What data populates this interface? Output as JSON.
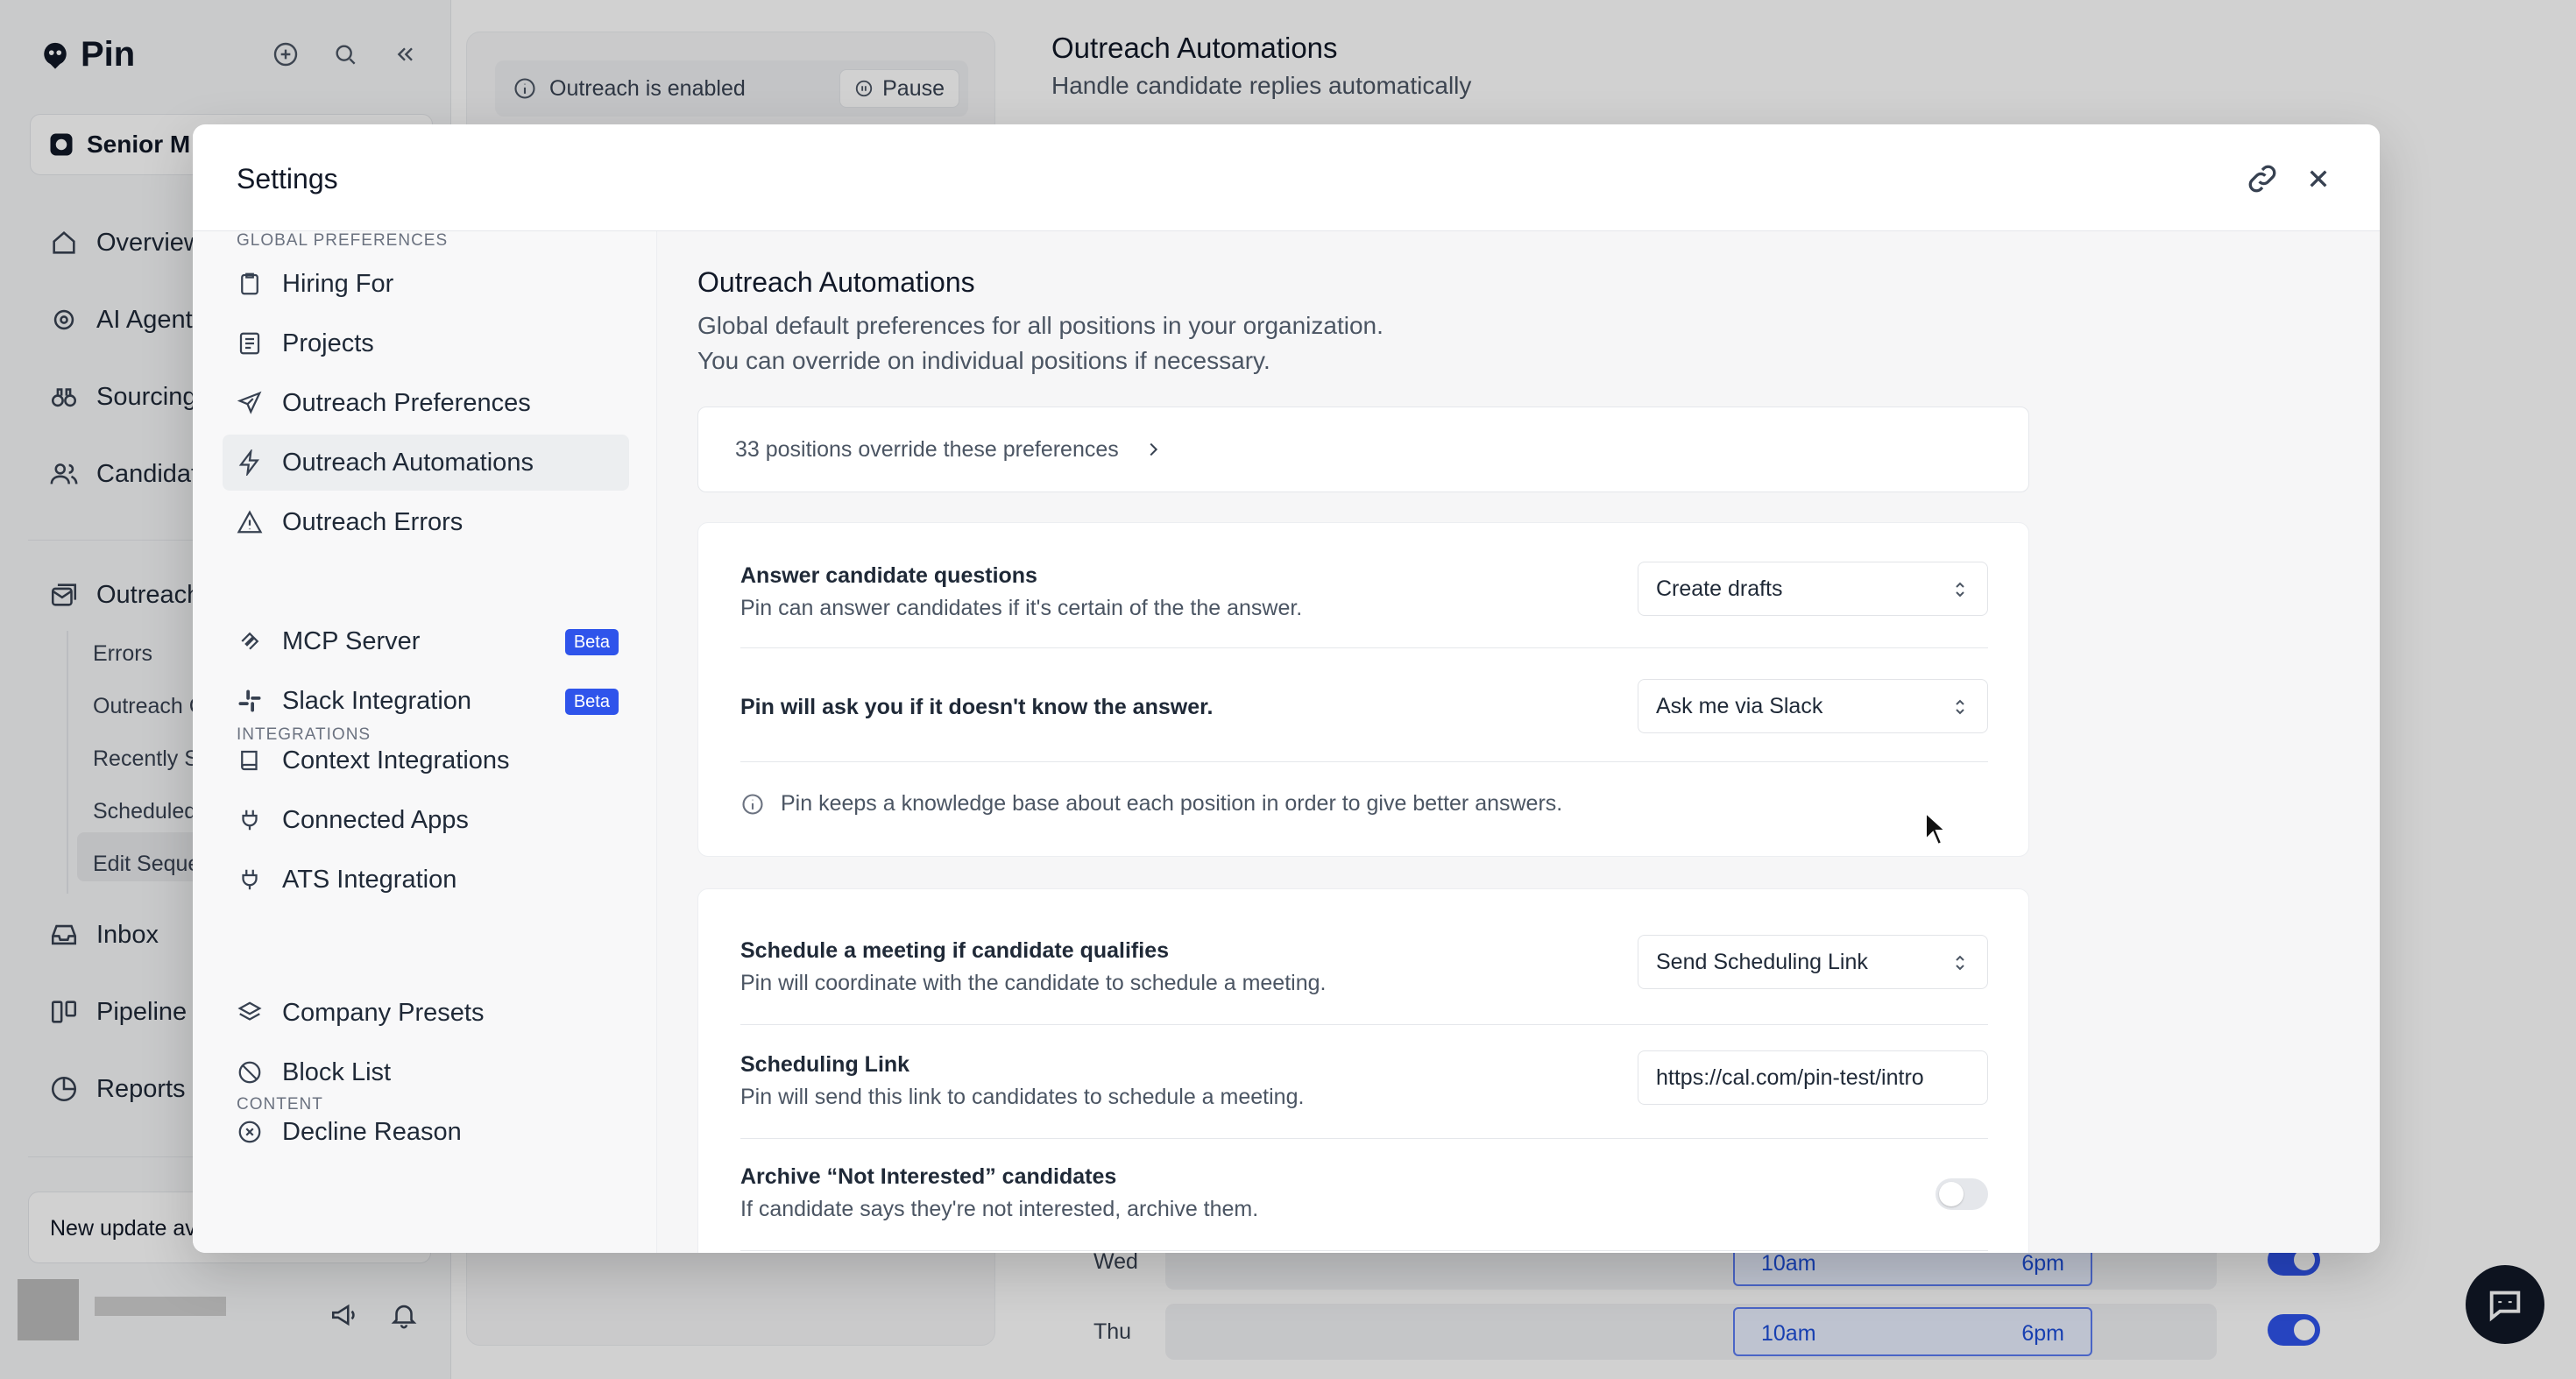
{
  "app": {
    "brand": "Pin",
    "project_name": "Senior M",
    "nav": [
      {
        "label": "Overview",
        "icon": "home-icon"
      },
      {
        "label": "AI Agent",
        "icon": "sparkle-gear-icon"
      },
      {
        "label": "Sourcing",
        "icon": "binoculars-icon"
      },
      {
        "label": "Candidat",
        "icon": "users-icon"
      },
      {
        "label": "Outreach",
        "icon": "mail-stack-icon"
      }
    ],
    "outreach_sub": [
      "Errors",
      "Outreach C",
      "Recently S",
      "Scheduled",
      "Edit Seque"
    ],
    "nav_bottom": [
      {
        "label": "Inbox",
        "icon": "inbox-icon"
      },
      {
        "label": "Pipeline",
        "icon": "columns-icon"
      },
      {
        "label": "Reports",
        "icon": "pie-chart-icon"
      }
    ],
    "update_text": "New update av",
    "outreach_status": "Outreach is enabled",
    "pause_label": "Pause",
    "page_title": "Outreach Automations",
    "page_subtitle": "Handle candidate replies automatically",
    "schedule": [
      {
        "day": "Wed",
        "start": "10am",
        "end": "6pm",
        "enabled": true
      },
      {
        "day": "Thu",
        "start": "10am",
        "end": "6pm",
        "enabled": true
      }
    ]
  },
  "modal": {
    "title": "Settings",
    "nav_sections": [
      {
        "label": "GLOBAL PREFERENCES",
        "items": [
          {
            "label": "Hiring For",
            "icon": "clipboard-icon"
          },
          {
            "label": "Projects",
            "icon": "list-doc-icon"
          },
          {
            "label": "Outreach Preferences",
            "icon": "send-icon"
          },
          {
            "label": "Outreach Automations",
            "icon": "lightning-icon",
            "active": true
          },
          {
            "label": "Outreach Errors",
            "icon": "warning-icon"
          }
        ]
      },
      {
        "label": "INTEGRATIONS",
        "items": [
          {
            "label": "MCP Server",
            "icon": "mcp-icon",
            "badge": "Beta"
          },
          {
            "label": "Slack Integration",
            "icon": "slack-icon",
            "badge": "Beta"
          },
          {
            "label": "Context Integrations",
            "icon": "book-icon"
          },
          {
            "label": "Connected Apps",
            "icon": "plug-icon"
          },
          {
            "label": "ATS Integration",
            "icon": "plug-icon"
          }
        ]
      },
      {
        "label": "CONTENT",
        "items": [
          {
            "label": "Company Presets",
            "icon": "layers-icon"
          },
          {
            "label": "Block List",
            "icon": "ban-icon"
          },
          {
            "label": "Decline Reason",
            "icon": "x-circle-icon"
          }
        ]
      }
    ],
    "content": {
      "title": "Outreach Automations",
      "desc_line1": "Global default preferences for all positions in your organization.",
      "desc_line2": "You can override on individual positions if necessary.",
      "override_text": "33 positions override these preferences",
      "answer_questions": {
        "title": "Answer candidate questions",
        "desc": "Pin can answer candidates if it's certain of the the answer.",
        "value": "Create drafts"
      },
      "unknown_answer": {
        "title": "Pin will ask you if it doesn't know the answer.",
        "value": "Ask me via Slack"
      },
      "knowledge_note": "Pin keeps a knowledge base about each position in order to give better answers.",
      "schedule_meeting": {
        "title": "Schedule a meeting if candidate qualifies",
        "desc": "Pin will coordinate with the candidate to schedule a meeting.",
        "value": "Send Scheduling Link"
      },
      "scheduling_link": {
        "title": "Scheduling Link",
        "desc": "Pin will send this link to candidates to schedule a meeting.",
        "value": "https://cal.com/pin-test/intro"
      },
      "archive": {
        "title": "Archive “Not Interested” candidates",
        "desc": "If candidate says they're not interested, archive them.",
        "enabled": false
      }
    }
  }
}
